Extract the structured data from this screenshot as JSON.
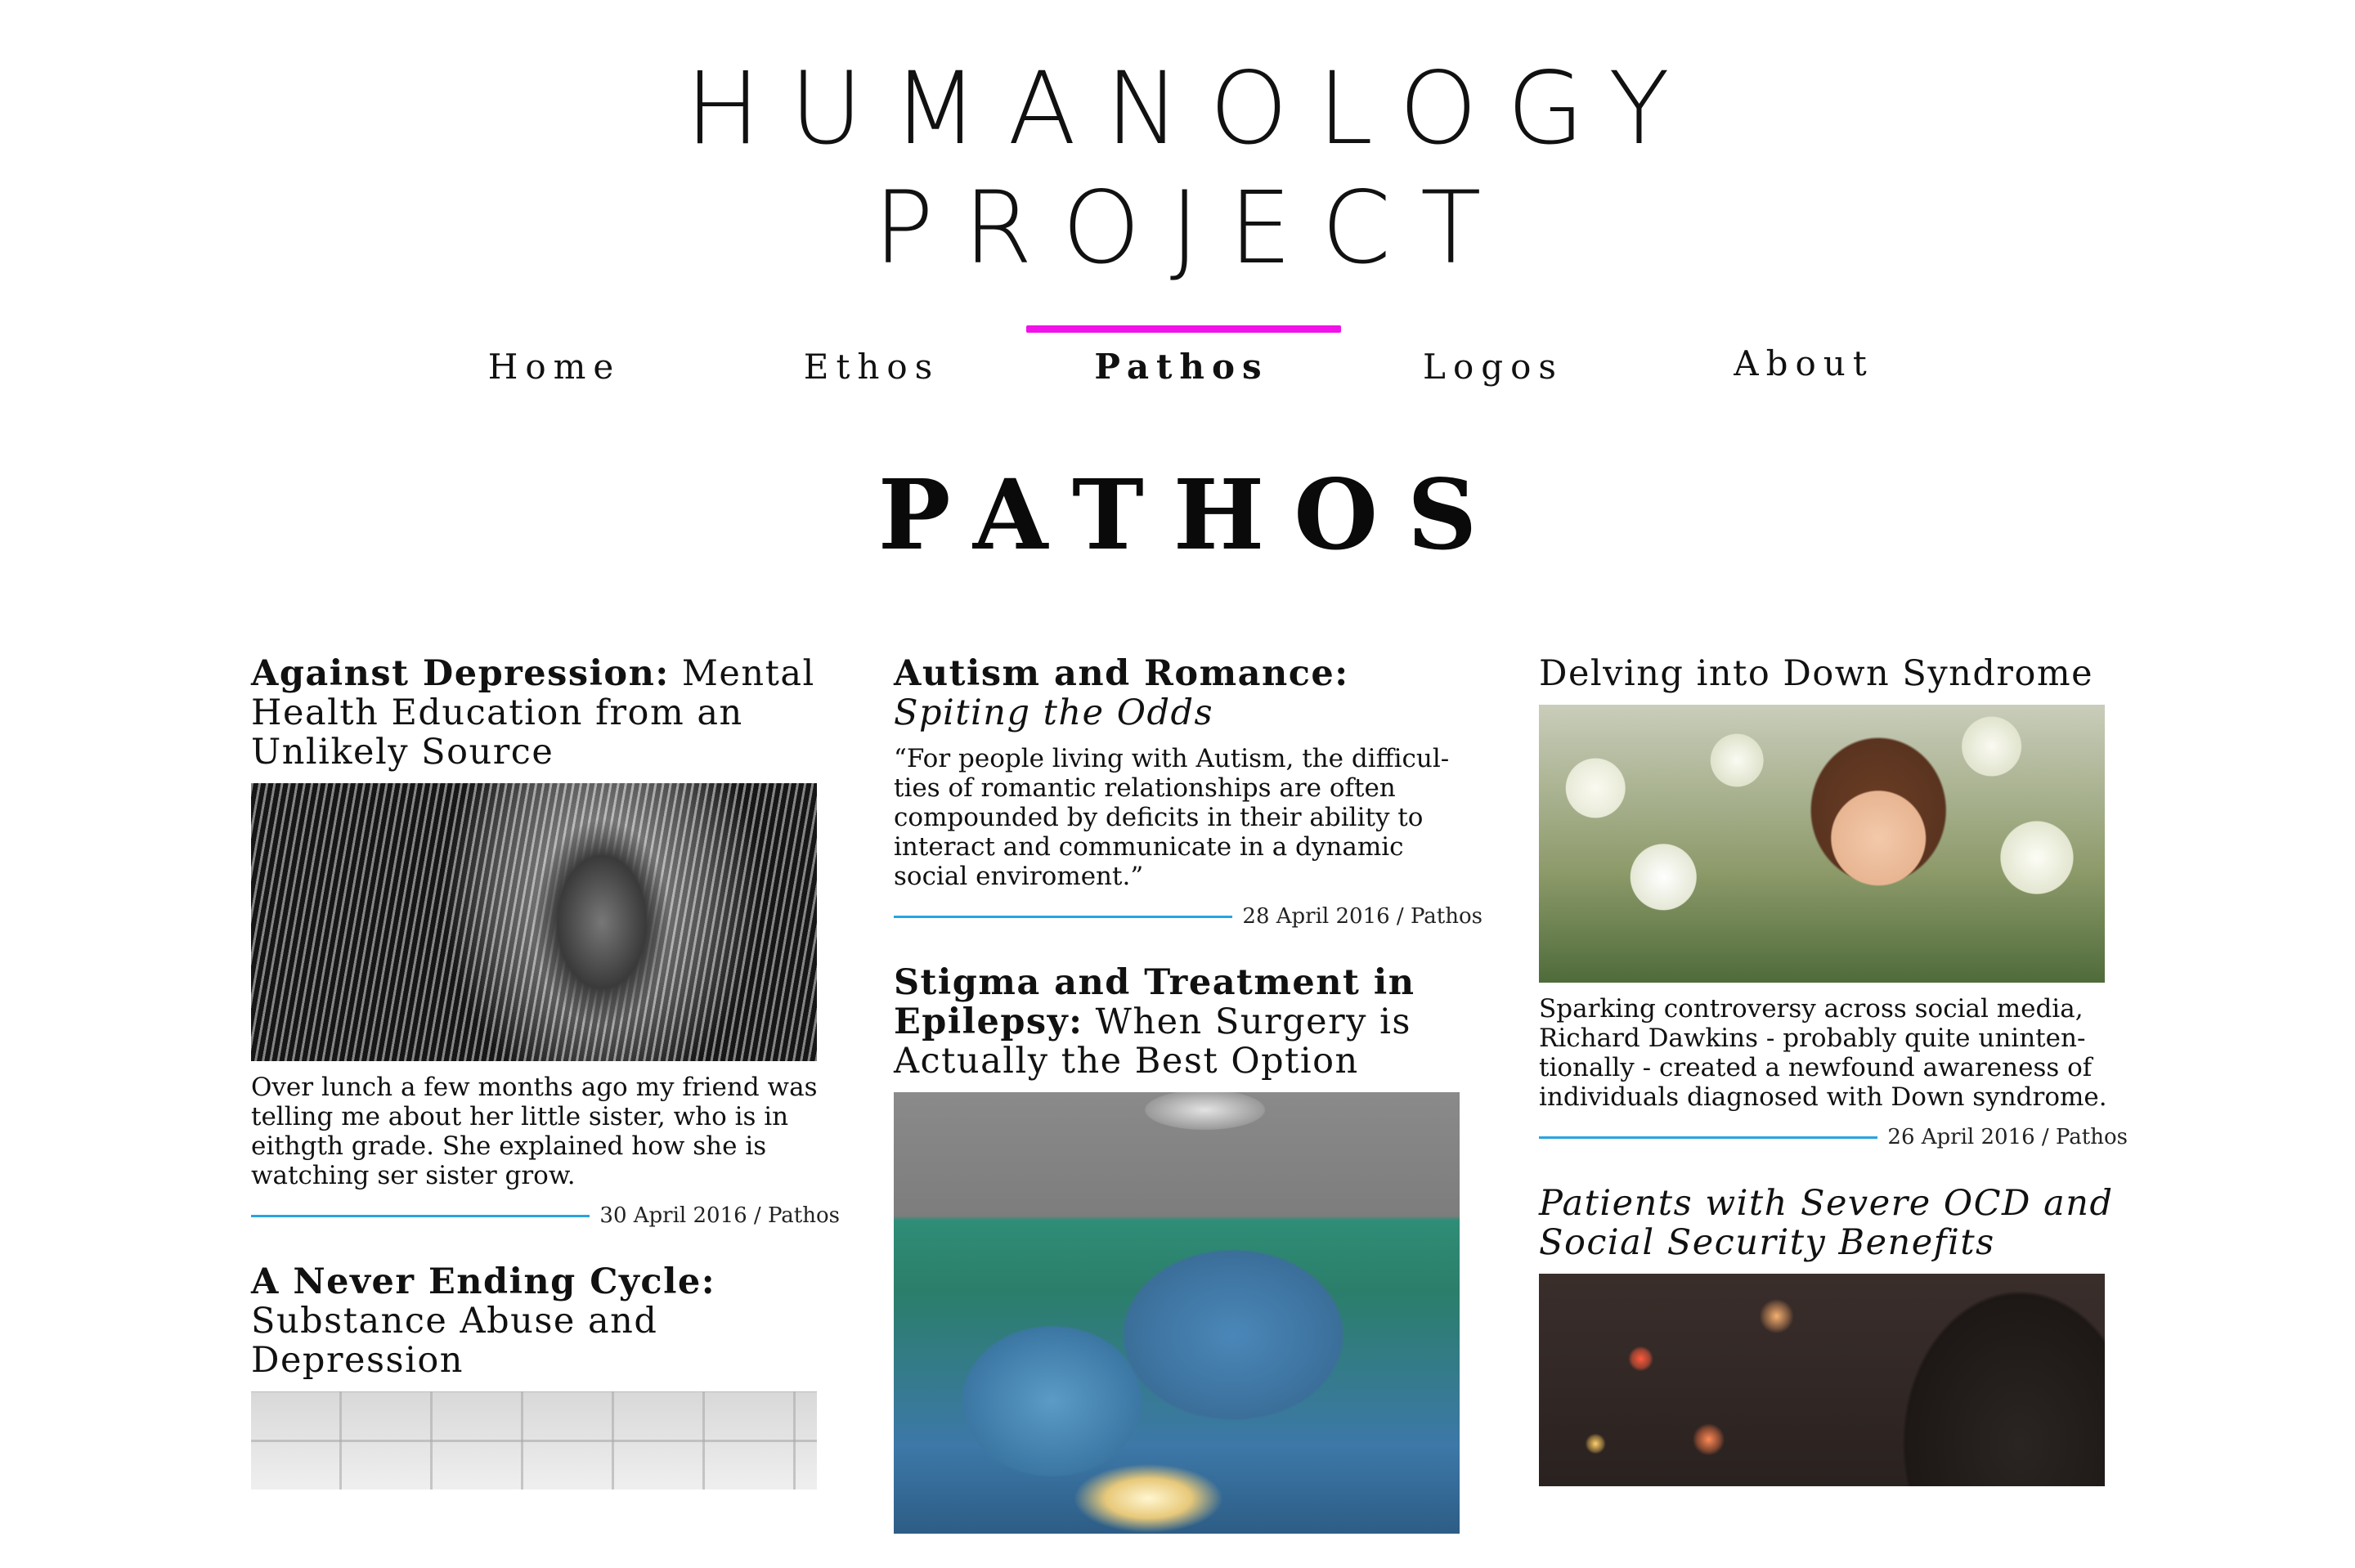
{
  "site": {
    "title_line1": "HUMANOLOGY",
    "title_line2": "PROJECT"
  },
  "nav": {
    "items": [
      {
        "label": "Home",
        "active": false
      },
      {
        "label": "Ethos",
        "active": false
      },
      {
        "label": "Pathos",
        "active": true
      },
      {
        "label": "Logos",
        "active": false
      },
      {
        "label": "About",
        "active": false
      }
    ],
    "accent_color": "#f012e9"
  },
  "page": {
    "heading": "PATHOS"
  },
  "meta_line_color": "#2aa3e0",
  "columns": {
    "col1": [
      {
        "title_bold": "Against Depression:",
        "title_rest": " Mental Health Education from an Unlikely Source",
        "image": "woman-with-long-hair-bw-photo",
        "excerpt": "Over lunch a few months ago my friend was telling me about her little sister, who is in eithgth grade. She explained how she is watching ser sister grow.",
        "date": "30 April 2016",
        "category": "Pathos"
      },
      {
        "title_bold": "A Never Ending Cycle:",
        "title_rest": " Substance Abuse and Depression",
        "image": "tiled-wall-photo"
      }
    ],
    "col2": [
      {
        "title_bold": "Autism and Romance:",
        "title_italic": "Spiting the Odds",
        "excerpt": "“For people living with Autism, the difficul-ties of romantic relationships are often compounded by deficits in their ability to interact and communicate in a dynamic social enviroment.”",
        "date": "28 April 2016",
        "category": "Pathos"
      },
      {
        "title_bold": "Stigma and Treatment in Epilepsy:",
        "title_rest": " When Surgery is Actually the Best Option",
        "image": "surgeons-operating-photo"
      }
    ],
    "col3": [
      {
        "title": "Delving into Down Syndrome",
        "image": "smiling-girl-with-flowers-photo",
        "excerpt": "Sparking controversy across social media, Richard Dawkins - probably quite uninten-tionally - created a newfound awareness of individuals diagnosed with Down syndrome.",
        "date": "26 April 2016",
        "category": "Pathos"
      },
      {
        "title_italic": "Patients with Severe OCD and Social Security Benefits",
        "image": "blurred-city-lights-photo"
      }
    ]
  },
  "meta_separator": " / "
}
